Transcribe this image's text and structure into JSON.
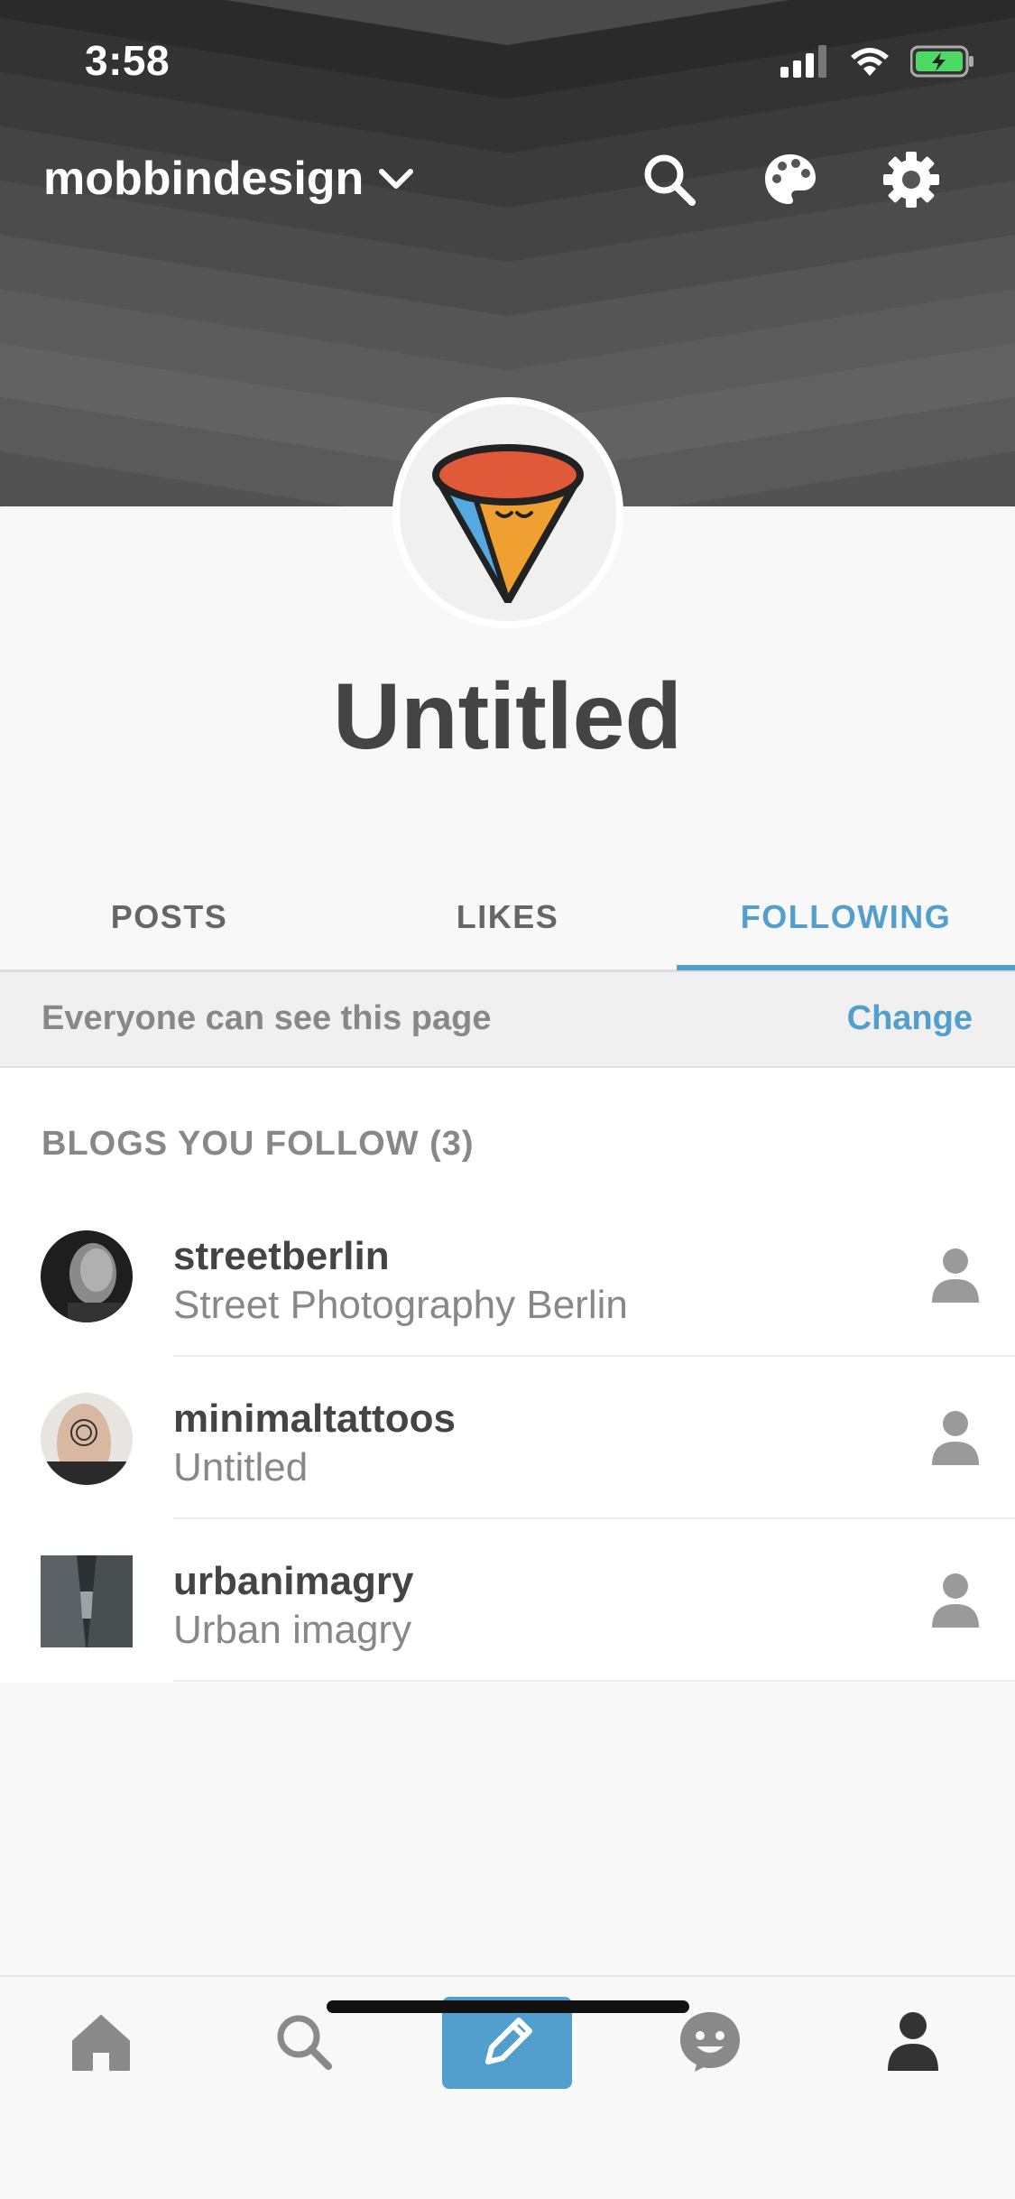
{
  "status_bar": {
    "time": "3:58"
  },
  "header": {
    "blog_name": "mobbindesign",
    "icons": [
      "chevron-down-icon",
      "search-icon",
      "palette-icon",
      "gear-icon"
    ]
  },
  "profile": {
    "title": "Untitled"
  },
  "tabs": [
    {
      "label": "POSTS",
      "active": false
    },
    {
      "label": "LIKES",
      "active": false
    },
    {
      "label": "FOLLOWING",
      "active": true
    }
  ],
  "visibility": {
    "text": "Everyone can see this page",
    "action": "Change"
  },
  "following": {
    "heading": "BLOGS YOU FOLLOW (3)",
    "blogs": [
      {
        "name": "streetberlin",
        "description": "Street Photography Berlin"
      },
      {
        "name": "minimaltattoos",
        "description": "Untitled"
      },
      {
        "name": "urbanimagry",
        "description": "Urban imagry"
      }
    ]
  },
  "bottom_nav": {
    "items": [
      "home-icon",
      "search-icon",
      "compose-icon",
      "emoji-icon",
      "account-icon"
    ]
  },
  "colors": {
    "accent": "#529ecc",
    "text": "#444444",
    "muted": "#888888"
  }
}
